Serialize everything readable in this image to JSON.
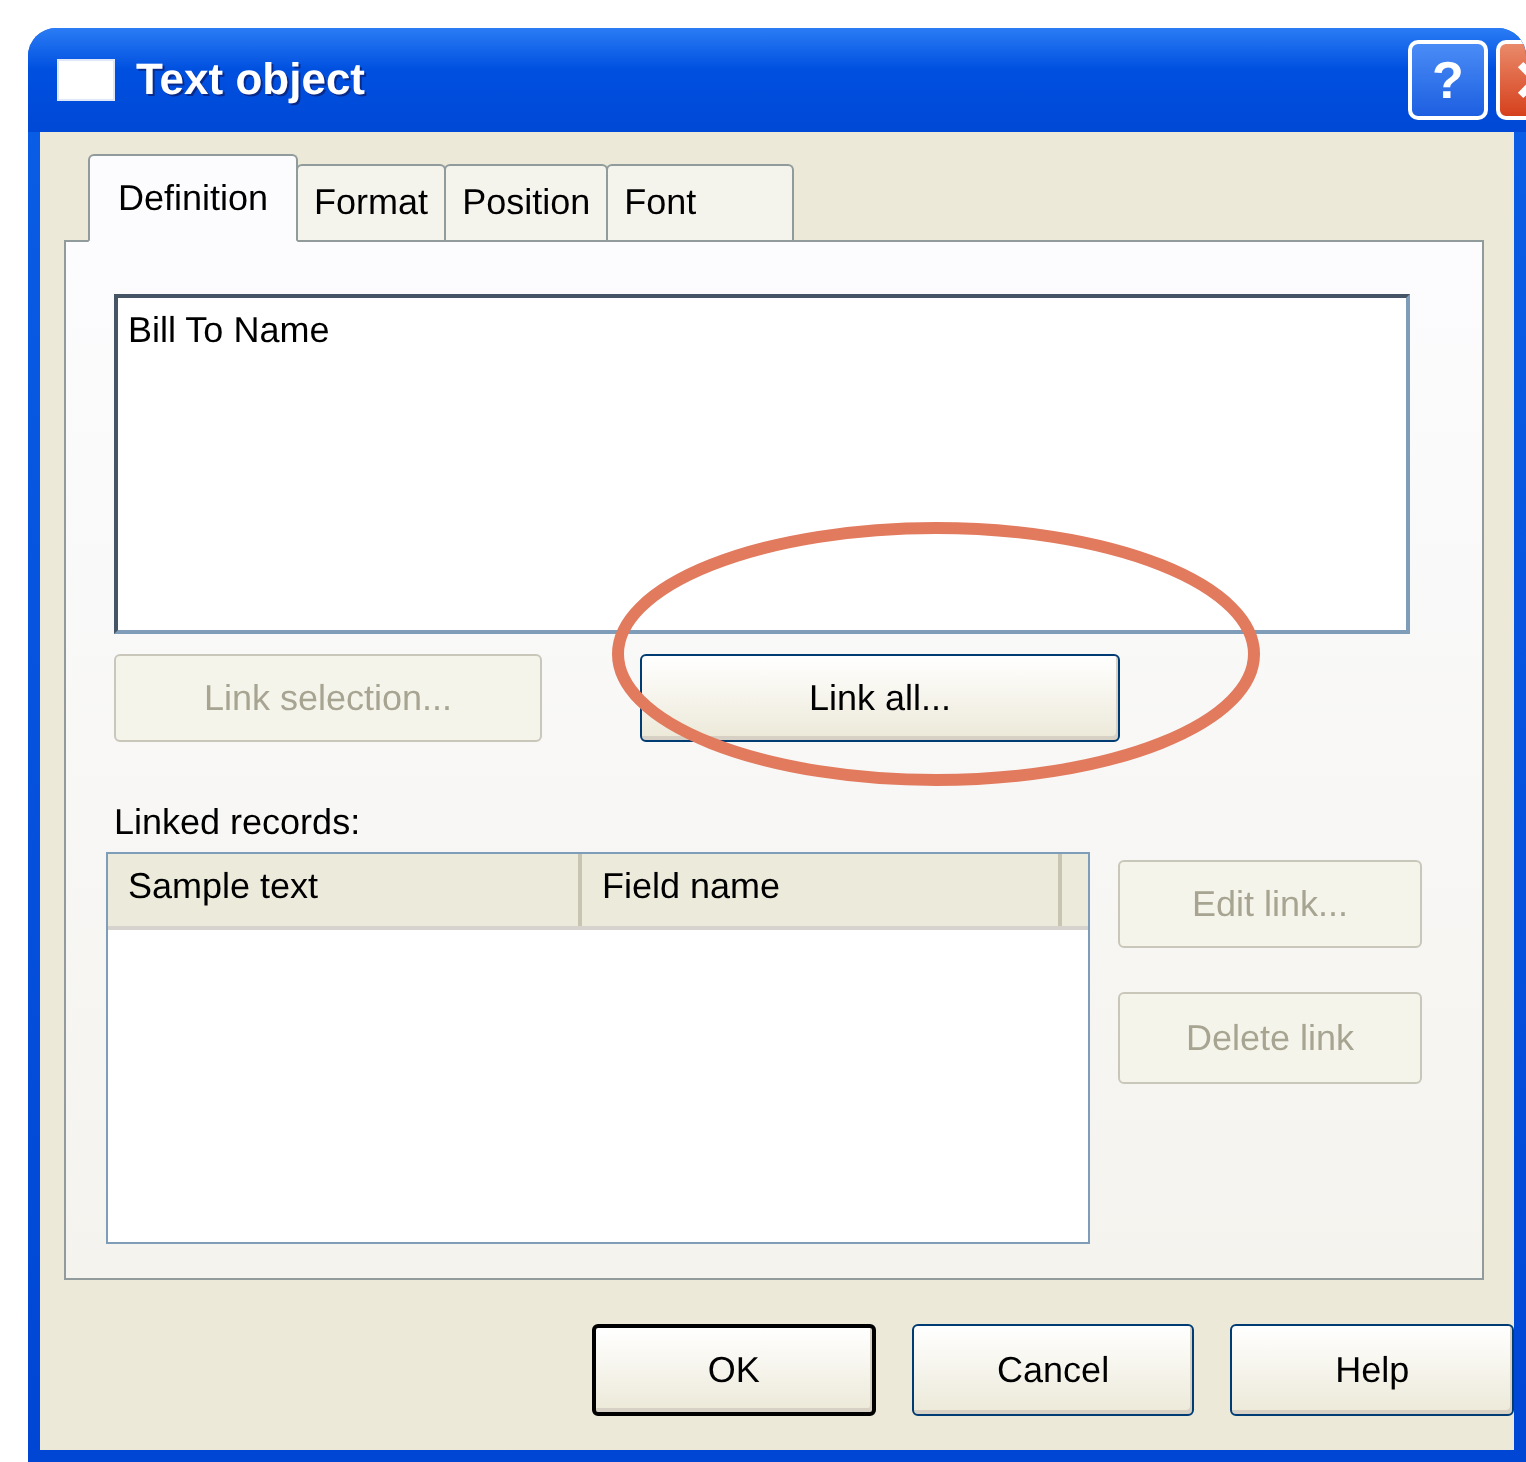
{
  "window": {
    "title": "Text object",
    "help_button": "?"
  },
  "tabs": [
    {
      "label": "Definition",
      "selected": true
    },
    {
      "label": "Format",
      "selected": false
    },
    {
      "label": "Position",
      "selected": false
    },
    {
      "label": "Font",
      "selected": false
    }
  ],
  "text_box": {
    "value": "Bill To Name"
  },
  "link_buttons": [
    {
      "label": "Link selection...",
      "disabled": true
    },
    {
      "label": "Link all...",
      "disabled": false
    }
  ],
  "annotation": {
    "kind": "ellipse"
  },
  "linked_records": {
    "label": "Linked records:",
    "columns": [
      "Sample text",
      "Field name"
    ]
  },
  "side_buttons": [
    {
      "label": "Edit link...",
      "disabled": true
    },
    {
      "label": "Delete link",
      "disabled": true
    }
  ],
  "buttons": [
    {
      "label": "OK",
      "default": true
    },
    {
      "label": "Cancel",
      "default": false
    },
    {
      "label": "Help",
      "default": false
    }
  ]
}
